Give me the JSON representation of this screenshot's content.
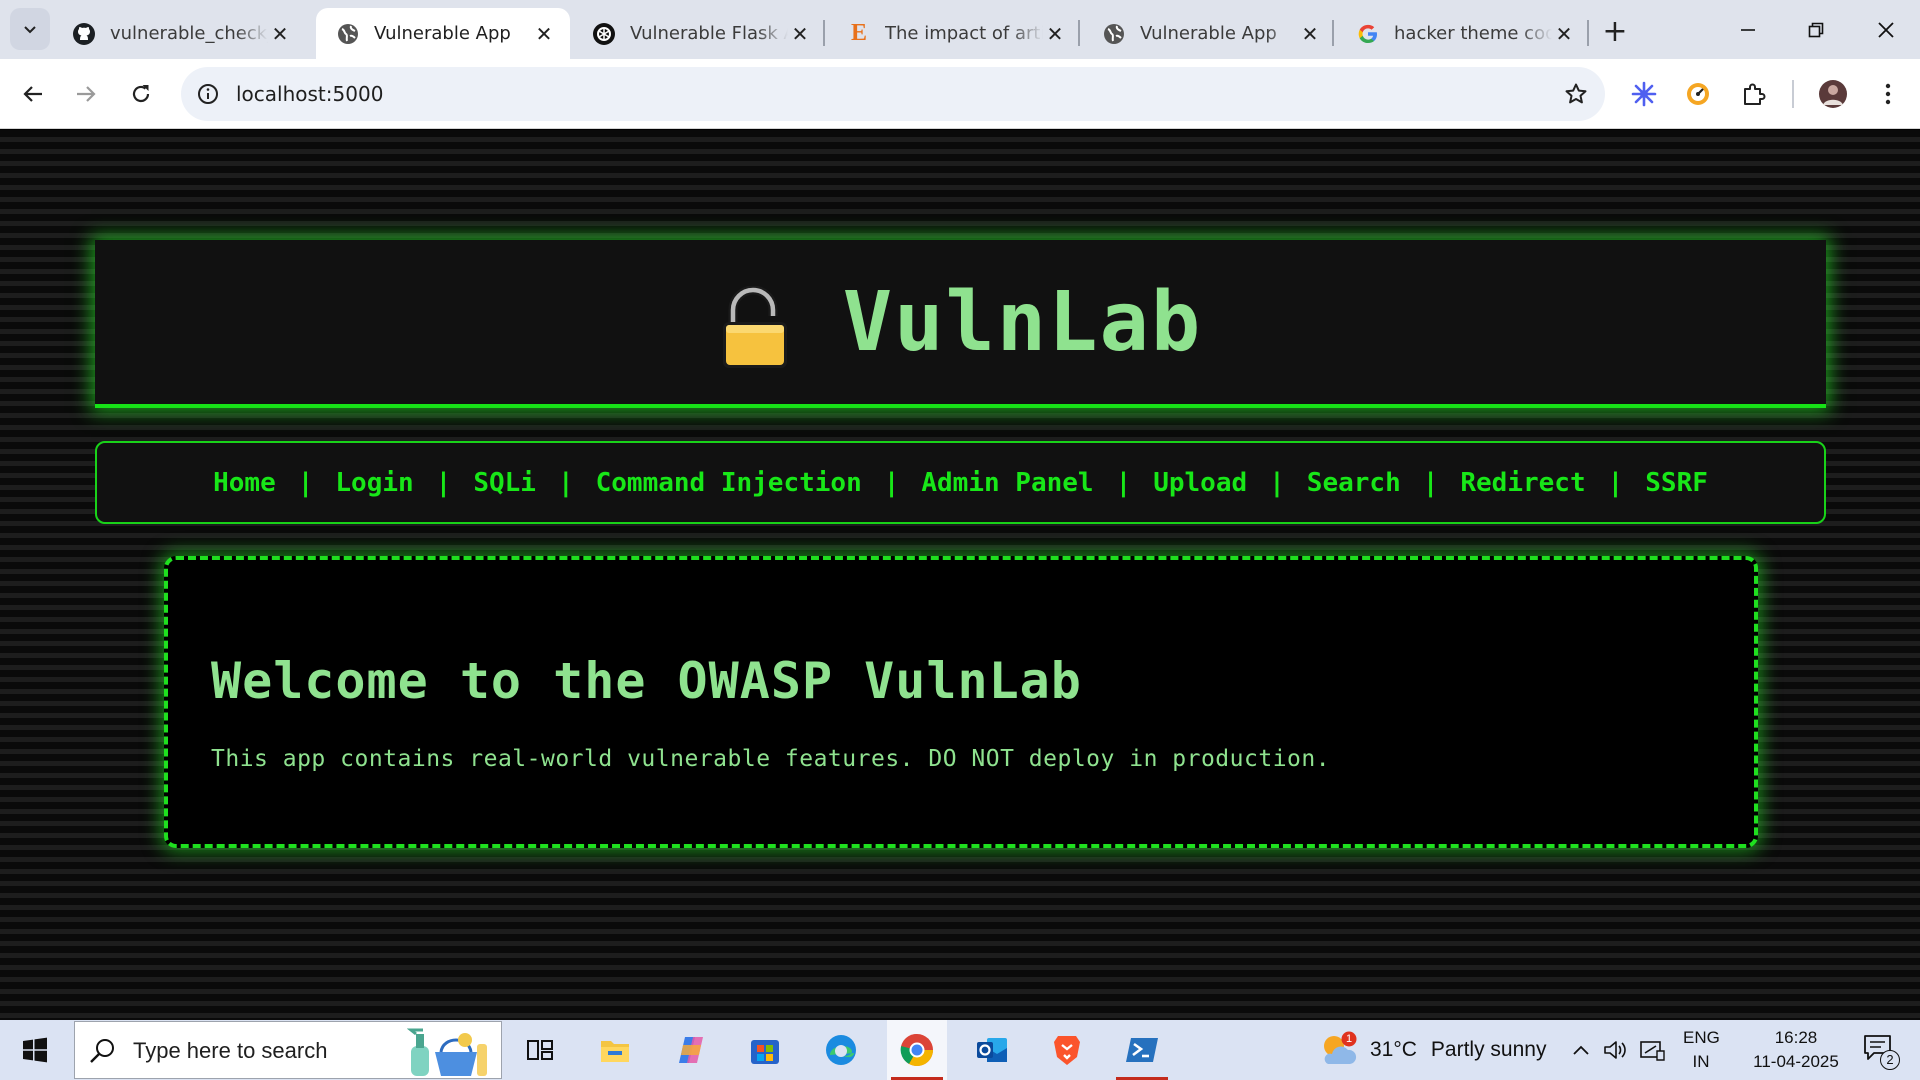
{
  "browser": {
    "tabs": [
      {
        "title": "vulnerable_check_a",
        "icon": "github-icon",
        "active": false
      },
      {
        "title": "Vulnerable App",
        "icon": "globe-icon",
        "active": true
      },
      {
        "title": "Vulnerable Flask Ap",
        "icon": "chatgpt-icon",
        "active": false
      },
      {
        "title": "The impact of artifi",
        "icon": "e-letter-icon",
        "active": false
      },
      {
        "title": "Vulnerable App",
        "icon": "globe-icon",
        "active": false
      },
      {
        "title": "hacker theme code",
        "icon": "google-icon",
        "active": false
      }
    ],
    "new_tab_label": "+",
    "url": "localhost:5000"
  },
  "site": {
    "title": "VulnLab",
    "logo_icon": "unlocked-padlock-icon",
    "nav": {
      "items": [
        "Home",
        "Login",
        "SQLi",
        "Command Injection",
        "Admin Panel",
        "Upload",
        "Search",
        "Redirect",
        "SSRF"
      ],
      "separator": "|"
    },
    "content": {
      "heading": "Welcome to the OWASP VulnLab",
      "text": "This app contains real-world vulnerable features. DO NOT deploy in production."
    },
    "colors": {
      "accent": "#18e718",
      "text": "#8fe28f",
      "background": "#000000"
    }
  },
  "taskbar": {
    "search_placeholder": "Type here to search",
    "weather": {
      "temp": "31°C",
      "condition": "Partly sunny",
      "badge": "1"
    },
    "language": {
      "line1": "ENG",
      "line2": "IN"
    },
    "clock": {
      "time": "16:28",
      "date": "11-04-2025"
    },
    "notifications_count": "2"
  }
}
